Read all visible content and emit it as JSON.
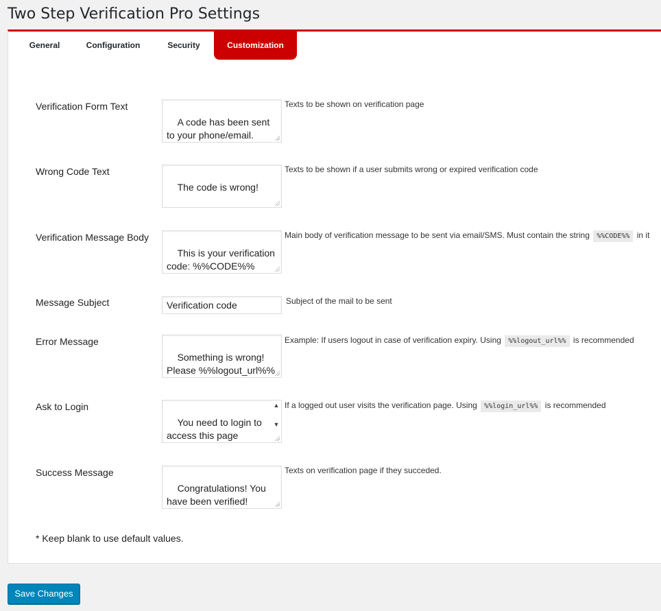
{
  "page": {
    "title": "Two Step Verification Pro Settings"
  },
  "tabs": [
    {
      "label": "General",
      "active": false
    },
    {
      "label": "Configuration",
      "active": false
    },
    {
      "label": "Security",
      "active": false
    },
    {
      "label": "Customization",
      "active": true
    }
  ],
  "fields": {
    "verification_form_text": {
      "label": "Verification Form Text",
      "value": "A code has been sent to your phone/email.",
      "description": "Texts to be shown on verification page"
    },
    "wrong_code_text": {
      "label": "Wrong Code Text",
      "value": "The code is wrong!",
      "description": "Texts to be shown if a user submits wrong or expired verification code"
    },
    "verification_message_body": {
      "label": "Verification Message Body",
      "value": "This is your verification code: %%CODE%%",
      "description_before": "Main body of verification message to be sent via email/SMS. Must contain the string",
      "description_code": "%%CODE%%",
      "description_after": "in it"
    },
    "message_subject": {
      "label": "Message Subject",
      "value": "Verification code",
      "description": "Subject of the mail to be sent"
    },
    "error_message": {
      "label": "Error Message",
      "value": "Something is wrong! Please %%logout_url%%",
      "description_before": "Example: If users logout in case of verification expiry. Using",
      "description_code": "%%logout_url%%",
      "description_after": "is recommended"
    },
    "ask_to_login": {
      "label": "Ask to Login",
      "value": "You need to login to access this page %%login_url%%",
      "description_before": "If a logged out user visits the verification page. Using",
      "description_code": "%%login_url%%",
      "description_after": "is recommended"
    },
    "success_message": {
      "label": "Success Message",
      "value": "Congratulations! You have been verified!",
      "description": "Texts on verification page if they succeded."
    }
  },
  "note": "* Keep blank to use default values.",
  "save_button": {
    "label": "Save Changes"
  },
  "colors": {
    "accent": "#cc0000",
    "primary_button": "#0085ba"
  }
}
